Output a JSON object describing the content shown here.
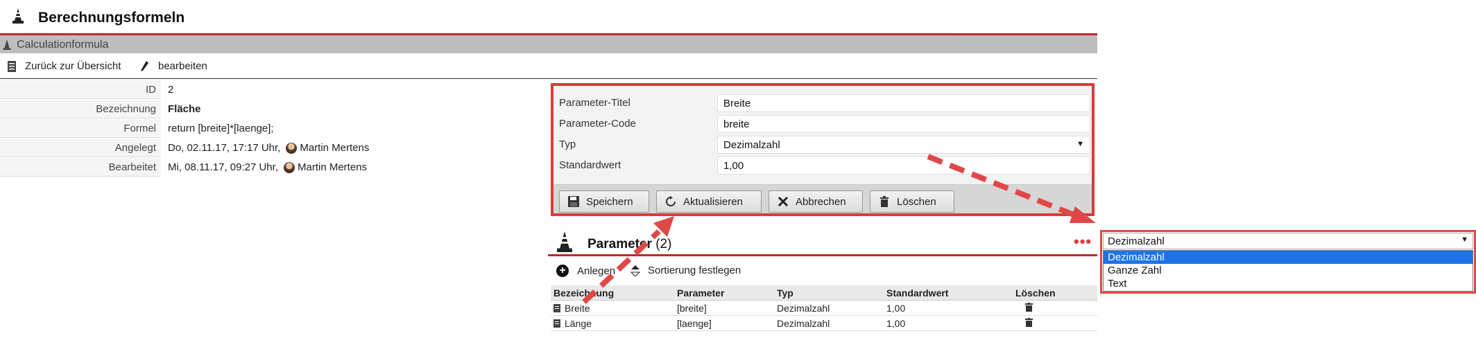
{
  "page": {
    "title": "Berechnungsformeln"
  },
  "section": {
    "title": "Calculationformula"
  },
  "toolbar": {
    "back_label": "Zurück zur Übersicht",
    "edit_label": "bearbeiten"
  },
  "details": {
    "id_label": "ID",
    "id_value": "2",
    "name_label": "Bezeichnung",
    "name_value": "Fläche",
    "formula_label": "Formel",
    "formula_value": "return [breite]*[laenge];",
    "created_label": "Angelegt",
    "created_value": "Do, 02.11.17, 17:17 Uhr,",
    "created_user": "Martin Mertens",
    "edited_label": "Bearbeitet",
    "edited_value": "Mi, 08.11.17, 09:27 Uhr,",
    "edited_user": "Martin Mertens"
  },
  "form": {
    "title_label": "Parameter-Titel",
    "title_value": "Breite",
    "code_label": "Parameter-Code",
    "code_value": "breite",
    "type_label": "Typ",
    "type_value": "Dezimalzahl",
    "default_label": "Standardwert",
    "default_value": "1,00",
    "save_label": "Speichern",
    "update_label": "Aktualisieren",
    "cancel_label": "Abbrechen",
    "delete_label": "Löschen"
  },
  "parameters": {
    "title": "Parameter",
    "count": "(2)",
    "add_label": "Anlegen",
    "sort_label": "Sortierung festlegen",
    "columns": [
      "Bezeichnung",
      "Parameter",
      "Typ",
      "Standardwert",
      "Löschen"
    ],
    "rows": [
      {
        "name": "Breite",
        "param": "[breite]",
        "type": "Dezimalzahl",
        "default": "1,00"
      },
      {
        "name": "Länge",
        "param": "[laenge]",
        "type": "Dezimalzahl",
        "default": "1,00"
      }
    ]
  },
  "more": {
    "dots": "•••"
  },
  "dropdown": {
    "selected": "Dezimalzahl",
    "options": [
      "Dezimalzahl",
      "Ganze Zahl",
      "Text"
    ]
  },
  "colors": {
    "accent_red": "#c0282c",
    "highlight_red": "#e04848",
    "select_blue": "#1e73e8"
  },
  "icons": [
    "cone-icon",
    "document-icon",
    "pencil-icon",
    "save-icon",
    "refresh-icon",
    "close-icon",
    "trash-icon",
    "plus-circle-icon",
    "sort-icon",
    "avatar",
    "chevron-down-icon"
  ]
}
